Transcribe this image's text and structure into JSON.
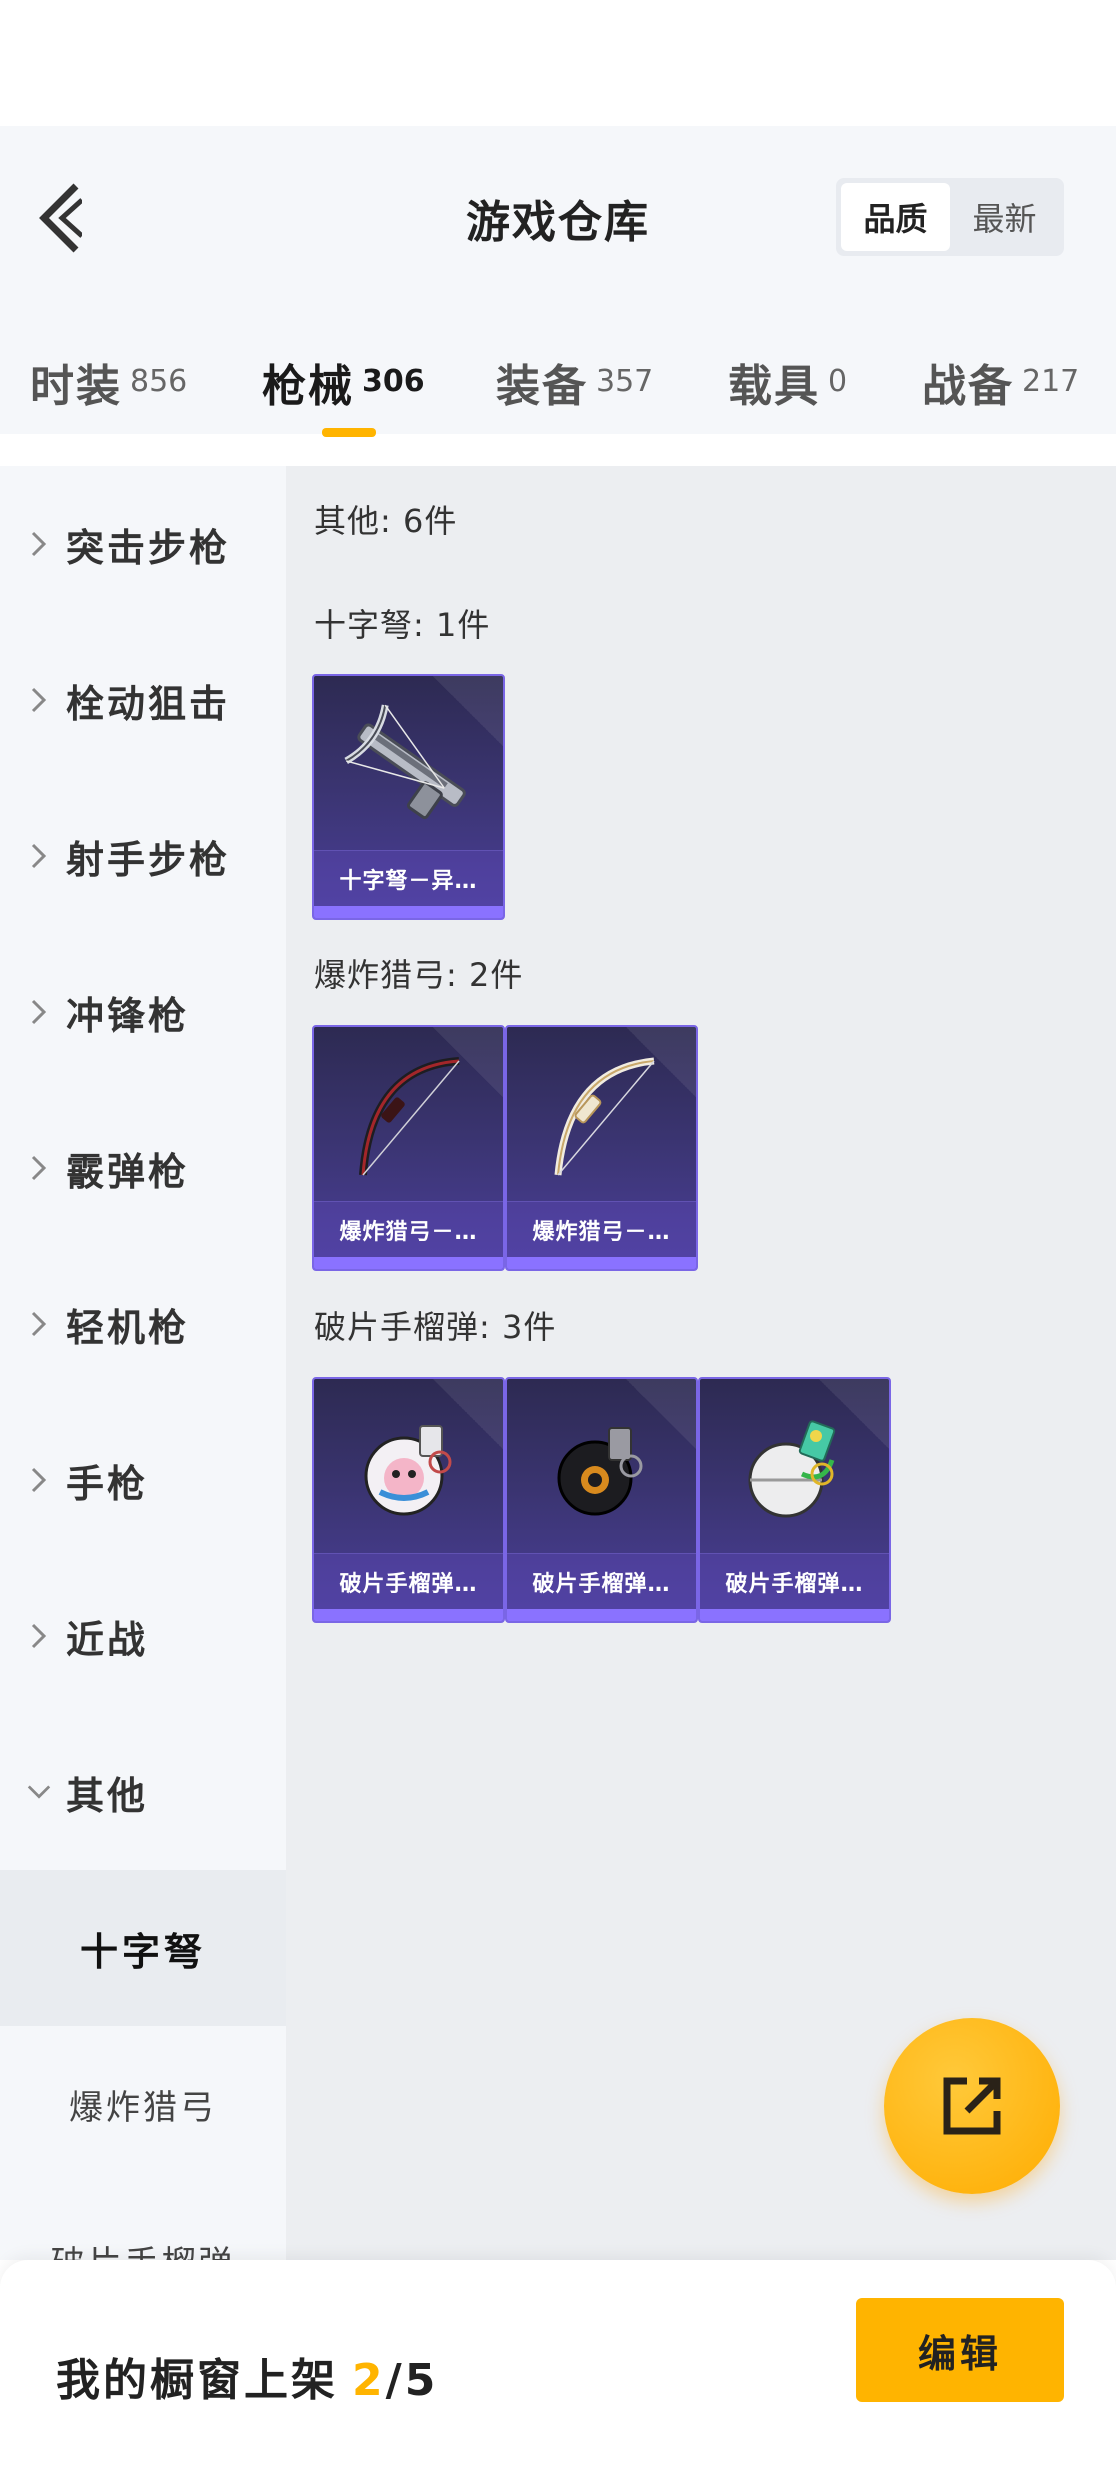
{
  "header": {
    "title": "游戏仓库",
    "sort_options": [
      {
        "label": "品质",
        "active": true
      },
      {
        "label": "最新",
        "active": false
      }
    ]
  },
  "category_tabs": [
    {
      "label": "时装",
      "count": "856",
      "active": false
    },
    {
      "label": "枪械",
      "count": "306",
      "active": true
    },
    {
      "label": "装备",
      "count": "357",
      "active": false
    },
    {
      "label": "载具",
      "count": "0",
      "active": false
    },
    {
      "label": "战备",
      "count": "217",
      "active": false
    }
  ],
  "sidebar": {
    "items": [
      {
        "label": "突击步枪",
        "expanded": false
      },
      {
        "label": "栓动狙击",
        "expanded": false
      },
      {
        "label": "射手步枪",
        "expanded": false
      },
      {
        "label": "冲锋枪",
        "expanded": false
      },
      {
        "label": "霰弹枪",
        "expanded": false
      },
      {
        "label": "轻机枪",
        "expanded": false
      },
      {
        "label": "手枪",
        "expanded": false
      },
      {
        "label": "近战",
        "expanded": false
      },
      {
        "label": "其他",
        "expanded": true
      }
    ],
    "subitems": [
      {
        "label": "十字弩",
        "active": true
      },
      {
        "label": "爆炸猎弓",
        "active": false
      },
      {
        "label": "破片手榴弹",
        "active": false
      }
    ]
  },
  "content": {
    "group_title": "其他: 6件",
    "sections": [
      {
        "title": "十字弩: 1件",
        "items": [
          {
            "name": "十字弩－异…",
            "icon": "crossbow-icon"
          }
        ]
      },
      {
        "title": "爆炸猎弓: 2件",
        "items": [
          {
            "name": "爆炸猎弓－…",
            "icon": "bow-red-icon"
          },
          {
            "name": "爆炸猎弓－…",
            "icon": "bow-white-icon"
          }
        ]
      },
      {
        "title": "破片手榴弹: 3件",
        "items": [
          {
            "name": "破片手榴弹…",
            "icon": "grenade-pink-icon"
          },
          {
            "name": "破片手榴弹…",
            "icon": "grenade-black-icon"
          },
          {
            "name": "破片手榴弹…",
            "icon": "grenade-white-icon"
          }
        ]
      }
    ]
  },
  "fab": {
    "icon": "share-external-icon"
  },
  "bottom_bar": {
    "label": "我的橱窗上架",
    "current": "2",
    "max": "/5",
    "edit_label": "编辑"
  },
  "colors": {
    "accent": "#ffb400",
    "card_border": "#7a66e6",
    "card_bg": "#3a3470"
  }
}
